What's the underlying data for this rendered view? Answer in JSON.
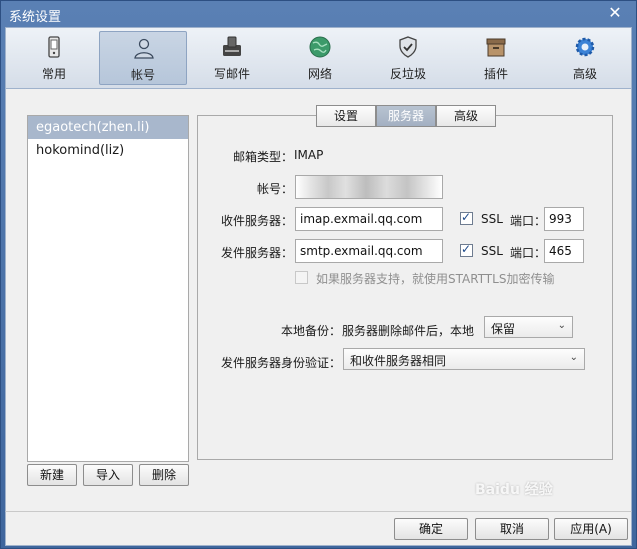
{
  "window": {
    "title": "系统设置",
    "close_glyph": "✕"
  },
  "toolbar": {
    "items": [
      {
        "label": "常用",
        "icon": "phone-icon"
      },
      {
        "label": "帐号",
        "icon": "user-icon"
      },
      {
        "label": "写邮件",
        "icon": "compose-icon"
      },
      {
        "label": "网络",
        "icon": "globe-icon"
      },
      {
        "label": "反垃圾",
        "icon": "shield-icon"
      },
      {
        "label": "插件",
        "icon": "box-icon"
      },
      {
        "label": "高级",
        "icon": "gear-icon"
      }
    ],
    "active_index": 1
  },
  "accounts": {
    "items": [
      "egaotech(zhen.li)",
      "hokomind(liz)"
    ],
    "selected_index": 0
  },
  "account_buttons": {
    "new": "新建",
    "import": "导入",
    "delete": "删除"
  },
  "tabs": {
    "items": [
      "设置",
      "服务器",
      "高级"
    ],
    "active_index": 1
  },
  "server": {
    "mailbox_type_label": "邮箱类型：",
    "mailbox_type_value": "IMAP",
    "account_label": "帐号：",
    "account_value": "",
    "incoming_label": "收件服务器：",
    "incoming_value": "imap.exmail.qq.com",
    "incoming_ssl": true,
    "ssl_label": "SSL",
    "port_label": "端口：",
    "incoming_port": "993",
    "outgoing_label": "发件服务器：",
    "outgoing_value": "smtp.exmail.qq.com",
    "outgoing_ssl": true,
    "outgoing_port": "465",
    "starttls_label": "如果服务器支持，就使用STARTTLS加密传输",
    "starttls_checked": false,
    "local_backup_label": "本地备份：",
    "local_backup_desc": "服务器删除邮件后，本地",
    "local_backup_value": "保留",
    "auth_label": "发件服务器身份验证：",
    "auth_value": "和收件服务器相同"
  },
  "footer": {
    "ok": "确定",
    "cancel": "取消",
    "apply": "应用(A)"
  },
  "watermark": "Baidu 经验",
  "colors": {
    "title_bar": "#4a72a8",
    "selected_row": "#a8b7cc",
    "active_tab": "#a3b0c2"
  }
}
